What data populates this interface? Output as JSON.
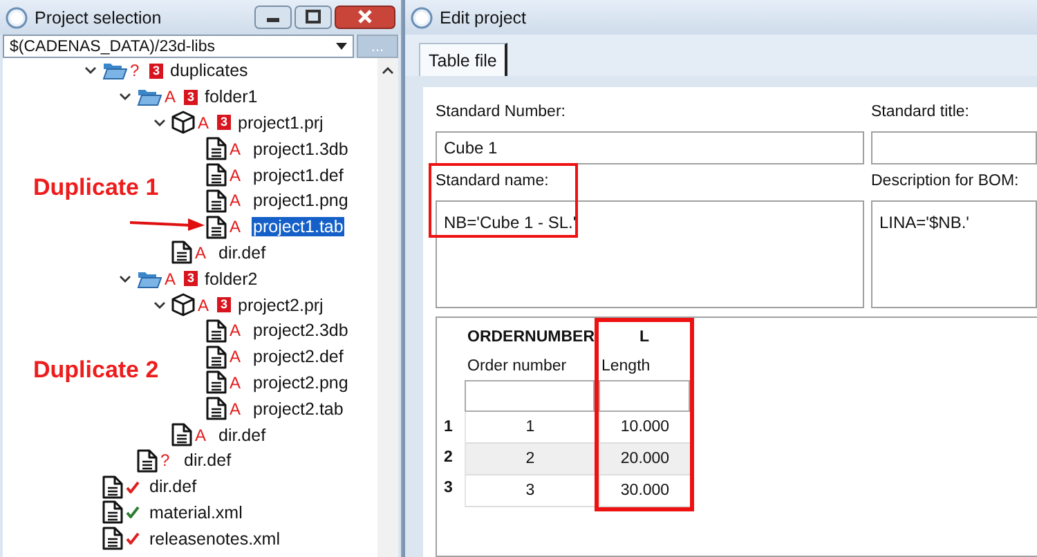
{
  "project_selection": {
    "title": "Project selection",
    "path": "$(CADENAS_DATA)/23d-libs",
    "browse_button": "...",
    "tree": [
      {
        "name": "duplicates",
        "kind": "folder",
        "status": {
          "kind": "letter",
          "text": "?"
        },
        "badge": "3",
        "expanded": true,
        "selected": false,
        "children": [
          {
            "name": "folder1",
            "kind": "folder",
            "status": {
              "kind": "letter",
              "text": "A"
            },
            "badge": "3",
            "expanded": true,
            "selected": false,
            "children": [
              {
                "name": "project1.prj",
                "kind": "cube",
                "status": {
                  "kind": "letter",
                  "text": "A"
                },
                "badge": "3",
                "expanded": true,
                "selected": false,
                "children": [
                  {
                    "name": "project1.3db",
                    "kind": "file",
                    "status": {
                      "kind": "letter",
                      "text": "A"
                    },
                    "selected": false
                  },
                  {
                    "name": "project1.def",
                    "kind": "file",
                    "status": {
                      "kind": "letter",
                      "text": "A"
                    },
                    "selected": false
                  },
                  {
                    "name": "project1.png",
                    "kind": "file",
                    "status": {
                      "kind": "letter",
                      "text": "A"
                    },
                    "selected": false
                  },
                  {
                    "name": "project1.tab",
                    "kind": "file",
                    "status": {
                      "kind": "letter",
                      "text": "A"
                    },
                    "selected": true
                  }
                ]
              },
              {
                "name": "dir.def",
                "kind": "file",
                "status": {
                  "kind": "letter",
                  "text": "A"
                },
                "selected": false
              }
            ]
          },
          {
            "name": "folder2",
            "kind": "folder",
            "status": {
              "kind": "letter",
              "text": "A"
            },
            "badge": "3",
            "expanded": true,
            "selected": false,
            "children": [
              {
                "name": "project2.prj",
                "kind": "cube",
                "status": {
                  "kind": "letter",
                  "text": "A"
                },
                "badge": "3",
                "expanded": true,
                "selected": false,
                "children": [
                  {
                    "name": "project2.3db",
                    "kind": "file",
                    "status": {
                      "kind": "letter",
                      "text": "A"
                    },
                    "selected": false
                  },
                  {
                    "name": "project2.def",
                    "kind": "file",
                    "status": {
                      "kind": "letter",
                      "text": "A"
                    },
                    "selected": false
                  },
                  {
                    "name": "project2.png",
                    "kind": "file",
                    "status": {
                      "kind": "letter",
                      "text": "A"
                    },
                    "selected": false
                  },
                  {
                    "name": "project2.tab",
                    "kind": "file",
                    "status": {
                      "kind": "letter",
                      "text": "A"
                    },
                    "selected": false
                  }
                ]
              },
              {
                "name": "dir.def",
                "kind": "file",
                "status": {
                  "kind": "letter",
                  "text": "A"
                },
                "selected": false
              }
            ]
          },
          {
            "name": "dir.def",
            "kind": "file",
            "status": {
              "kind": "letter",
              "text": "?"
            },
            "selected": false
          }
        ]
      },
      {
        "name": "dir.def",
        "kind": "file",
        "status": {
          "kind": "check",
          "color": "#e02020"
        },
        "selected": false
      },
      {
        "name": "material.xml",
        "kind": "file",
        "status": {
          "kind": "check",
          "color": "#2e7d32"
        },
        "selected": false
      },
      {
        "name": "releasenotes.xml",
        "kind": "file",
        "status": {
          "kind": "check",
          "color": "#e02020"
        },
        "selected": false
      }
    ]
  },
  "annotations": [
    {
      "text": "Duplicate 1",
      "arrow": true
    },
    {
      "text": "Duplicate 2",
      "arrow": false
    }
  ],
  "edit_project": {
    "title": "Edit project",
    "tabs": [
      {
        "label": "Table file",
        "selected": true
      }
    ],
    "fields": [
      {
        "label": "Standard Number:",
        "value": "Cube 1",
        "kind": "line",
        "highlighted": false
      },
      {
        "label": "Standard title:",
        "kind": "line",
        "highlighted": false
      },
      {
        "label": "Standard name:",
        "value": "NB='Cube 1 - SL.'",
        "kind": "multi",
        "highlighted": true
      },
      {
        "label": "Description for BOM:",
        "value": "LINA='$NB.'",
        "kind": "multi",
        "highlighted": false
      }
    ],
    "table": {
      "columns": [
        {
          "name": "ORDERNUMBER",
          "caption": "Order number",
          "highlighted": false
        },
        {
          "name": "L",
          "caption": "Length",
          "highlighted": true
        }
      ],
      "rows": [
        {
          "number": "1",
          "cells": [
            "1",
            "10.000"
          ]
        },
        {
          "number": "2",
          "cells": [
            "2",
            "20.000"
          ]
        },
        {
          "number": "3",
          "cells": [
            "3",
            "30.000"
          ]
        }
      ]
    }
  }
}
